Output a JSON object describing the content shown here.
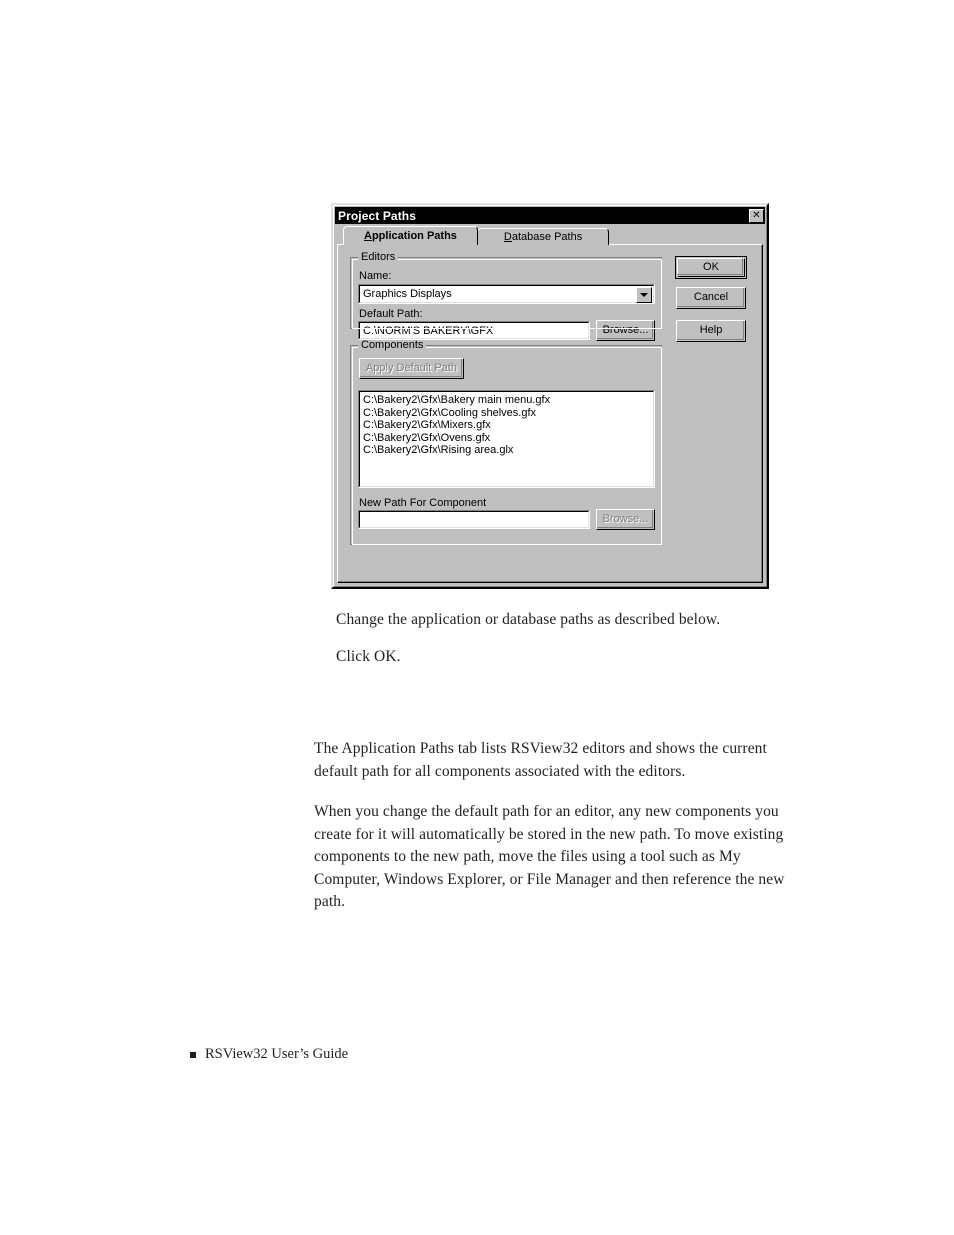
{
  "page": {
    "caption_paragraphs": [
      "Change the application or database paths as described below.",
      "Click OK."
    ],
    "body_paragraphs": [
      "The Application Paths tab lists RSView32 editors and shows the current default path for all components associated with the editors.",
      "When you change the default path for an editor, any new components you create for it will automatically be stored in the new path. To move existing components to the new path, move the files using a tool such as My Computer, Windows Explorer, or File Manager and then reference the new path."
    ],
    "footer": {
      "bullet": "square-bullet",
      "text": "RSView32  User’s Guide"
    }
  },
  "dialog": {
    "title": "Project Paths",
    "close_button": "✕",
    "tabs": [
      {
        "label": "Application Paths",
        "accel": "A",
        "active": true
      },
      {
        "label": "Database Paths",
        "accel": "D",
        "active": false
      }
    ],
    "groups": {
      "editors": {
        "legend": "Editors",
        "name_label": "Name:",
        "name_value": "Graphics Displays",
        "default_path_label": "Default Path:",
        "default_path_value": "C:\\NORM'S BAKERY\\GFX",
        "browse_label": "Browse...",
        "browse_enabled": true
      },
      "components": {
        "legend": "Components",
        "apply_default_path_label": "Apply Default Path",
        "apply_default_path_enabled": false,
        "items": [
          "C:\\Bakery2\\Gfx\\Bakery main menu.gfx",
          "C:\\Bakery2\\Gfx\\Cooling shelves.gfx",
          "C:\\Bakery2\\Gfx\\Mixers.gfx",
          "C:\\Bakery2\\Gfx\\Ovens.gfx",
          "C:\\Bakery2\\Gfx\\Rising area.glx"
        ],
        "new_path_label": "New Path For Component",
        "new_path_value": "",
        "browse_label": "Browse...",
        "browse_enabled": false
      }
    },
    "buttons": {
      "ok": "OK",
      "cancel": "Cancel",
      "help": "Help"
    },
    "colors": {
      "face": "#c0c0c0",
      "titlebar": "#000000",
      "titlebar_text": "#ffffff",
      "field": "#ffffff",
      "disabled_text": "#808080"
    }
  }
}
